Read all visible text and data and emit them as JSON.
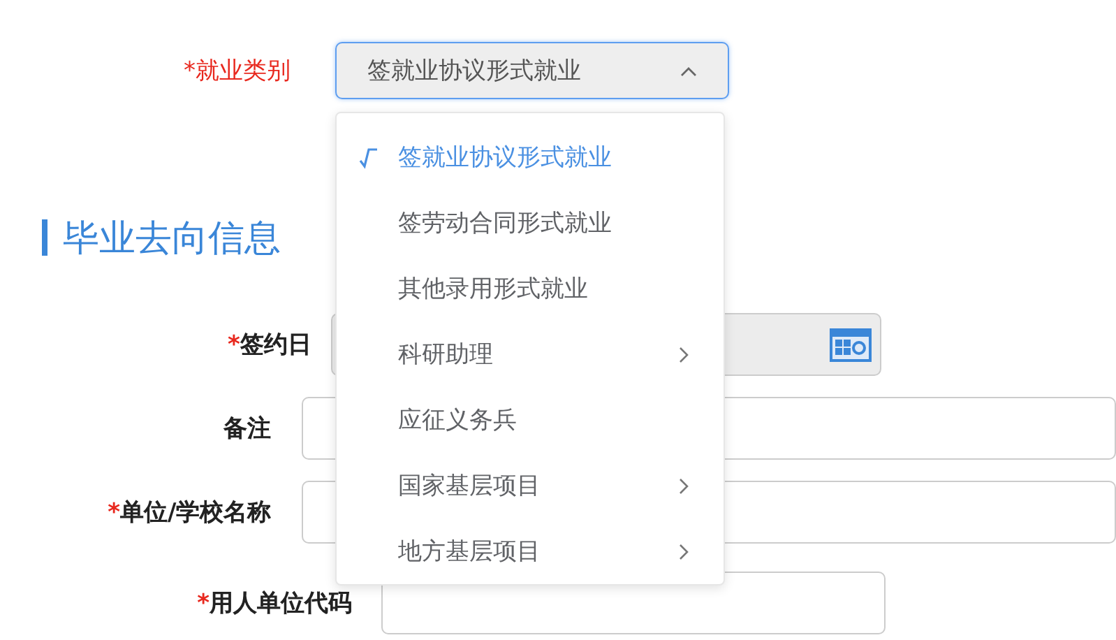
{
  "employment_type": {
    "label": "*就业类别",
    "value": "签就业协议形式就业",
    "expanded": true
  },
  "dropdown": {
    "options": [
      {
        "label": "签就业协议形式就业",
        "selected": true,
        "has_submenu": false
      },
      {
        "label": "签劳动合同形式就业",
        "selected": false,
        "has_submenu": false
      },
      {
        "label": "其他录用形式就业",
        "selected": false,
        "has_submenu": false
      },
      {
        "label": "科研助理",
        "selected": false,
        "has_submenu": true
      },
      {
        "label": "应征义务兵",
        "selected": false,
        "has_submenu": false
      },
      {
        "label": "国家基层项目",
        "selected": false,
        "has_submenu": true
      },
      {
        "label": "地方基层项目",
        "selected": false,
        "has_submenu": true
      }
    ]
  },
  "section": {
    "title": "毕业去向信息"
  },
  "fields": [
    {
      "kind": "date",
      "required_mark": "*",
      "label": "签约日",
      "disabled": true
    },
    {
      "kind": "text",
      "label": "备注",
      "disabled": false
    },
    {
      "kind": "text",
      "required_mark": "*",
      "label": "单位/学校名称",
      "disabled": false
    },
    {
      "kind": "text",
      "required_mark": "*",
      "label": "用人单位代码",
      "disabled": false
    }
  ]
}
